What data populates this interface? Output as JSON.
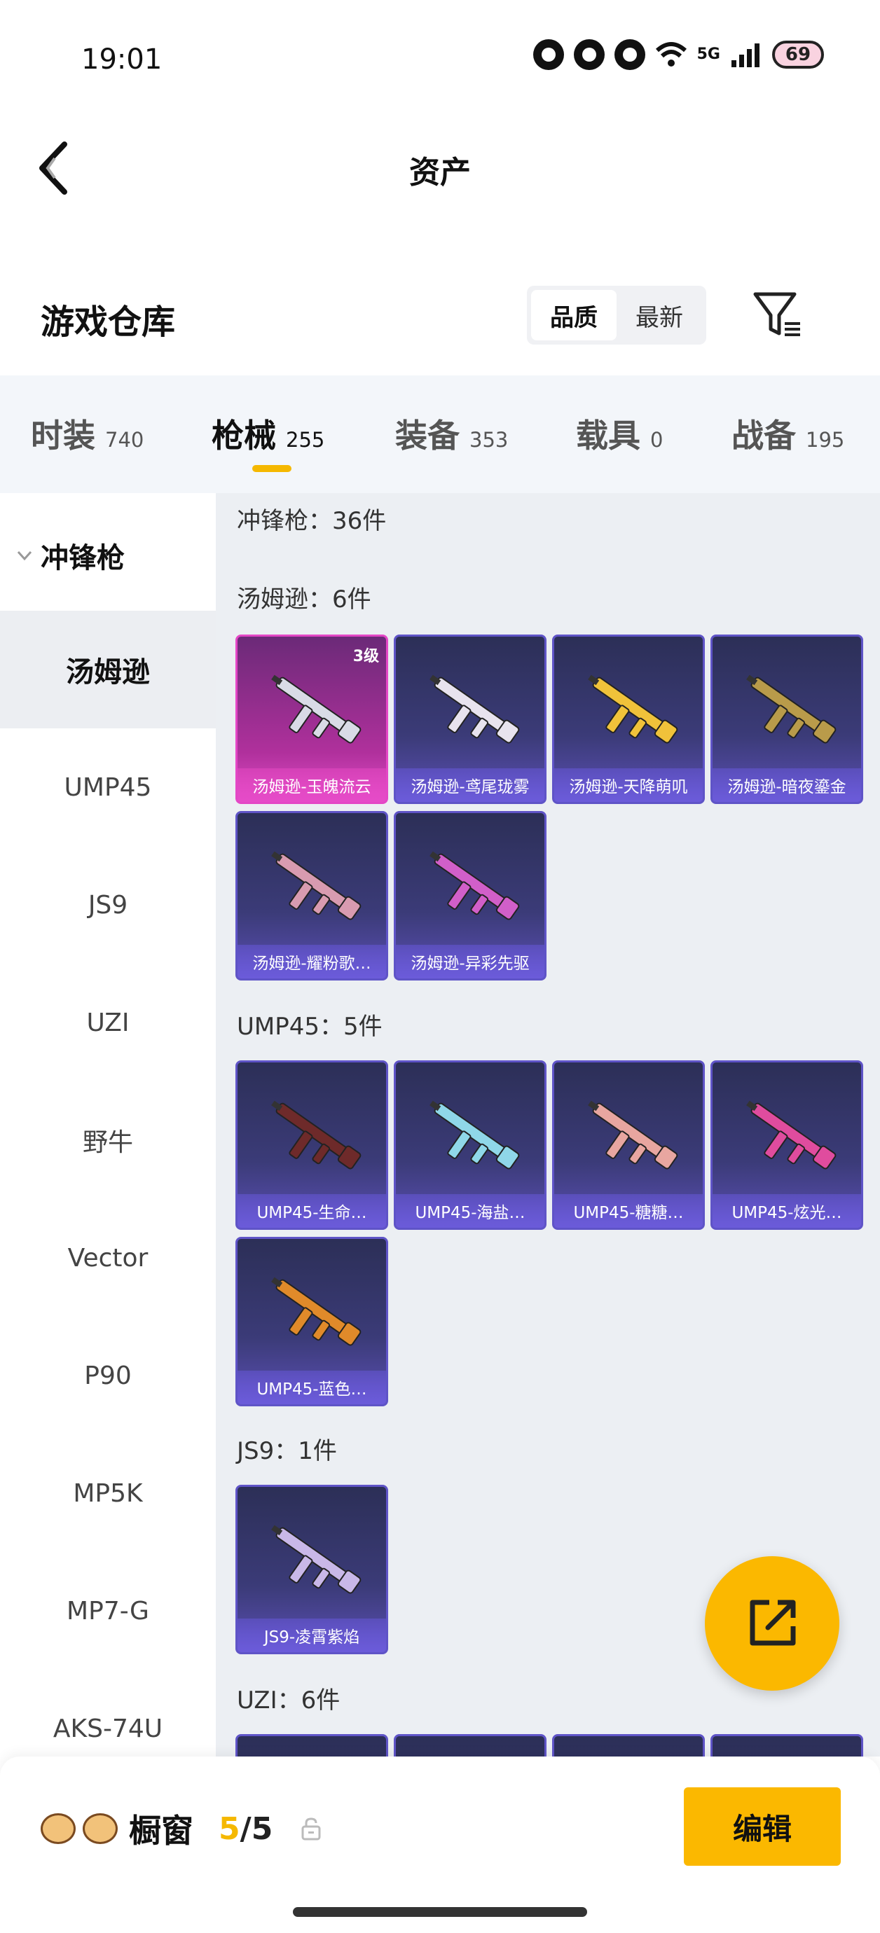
{
  "status_bar": {
    "time": "19:01",
    "network": "5G",
    "battery": "69"
  },
  "header": {
    "title": "资产"
  },
  "warehouse": {
    "title": "游戏仓库",
    "sort_options": [
      "品质",
      "最新"
    ],
    "active_sort": "品质"
  },
  "tabs": [
    {
      "label": "时装",
      "count": "740"
    },
    {
      "label": "枪械",
      "count": "255"
    },
    {
      "label": "装备",
      "count": "353"
    },
    {
      "label": "载具",
      "count": "0"
    },
    {
      "label": "战备",
      "count": "195"
    }
  ],
  "active_tab": "枪械",
  "sidebar": {
    "group": "冲锋枪",
    "items": [
      "汤姆逊",
      "UMP45",
      "JS9",
      "UZI",
      "野牛",
      "Vector",
      "P90",
      "MP5K",
      "MP7-G",
      "AKS-74U"
    ],
    "active": "汤姆逊"
  },
  "content": {
    "category_summary": "冲锋枪：36件",
    "sections": [
      {
        "title": "汤姆逊：6件",
        "items": [
          {
            "name": "汤姆逊-玉魄流云",
            "level": "3级",
            "rarity": "pink"
          },
          {
            "name": "汤姆逊-鸢尾珑雾",
            "rarity": "purple"
          },
          {
            "name": "汤姆逊-天降萌叽",
            "rarity": "purple"
          },
          {
            "name": "汤姆逊-暗夜鎏金",
            "rarity": "purple"
          },
          {
            "name": "汤姆逊-耀粉歌…",
            "rarity": "purple"
          },
          {
            "name": "汤姆逊-异彩先驱",
            "rarity": "purple"
          }
        ]
      },
      {
        "title": "UMP45：5件",
        "items": [
          {
            "name": "UMP45-生命…",
            "rarity": "purple"
          },
          {
            "name": "UMP45-海盐…",
            "rarity": "purple"
          },
          {
            "name": "UMP45-糖糖…",
            "rarity": "purple"
          },
          {
            "name": "UMP45-炫光…",
            "rarity": "purple"
          },
          {
            "name": "UMP45-蓝色…",
            "rarity": "purple"
          }
        ]
      },
      {
        "title": "JS9：1件",
        "items": [
          {
            "name": "JS9-凌霄紫焰",
            "rarity": "purple"
          }
        ]
      },
      {
        "title": "UZI：6件",
        "items": []
      }
    ]
  },
  "gun_colors": {
    "汤姆逊-玉魄流云": "#d9dbe6",
    "汤姆逊-鸢尾珑雾": "#e8e3ee",
    "汤姆逊-天降萌叽": "#f0c23a",
    "汤姆逊-暗夜鎏金": "#b99b4a",
    "汤姆逊-耀粉歌…": "#d89bb0",
    "汤姆逊-异彩先驱": "#d15fc9",
    "UMP45-生命…": "#6e2a2a",
    "UMP45-海盐…": "#8fd7e8",
    "UMP45-糖糖…": "#e8a6a0",
    "UMP45-炫光…": "#e04c9e",
    "UMP45-蓝色…": "#e08a2a",
    "JS9-凌霄紫焰": "#c9b8e8"
  },
  "bottom_bar": {
    "label": "橱窗",
    "current": "5",
    "total": "/5",
    "edit": "编辑"
  },
  "icons": {
    "back": "chevron-left-icon",
    "filter": "filter-icon",
    "share": "share-icon",
    "lock": "lock-icon"
  },
  "accent_color": "#fbb800"
}
